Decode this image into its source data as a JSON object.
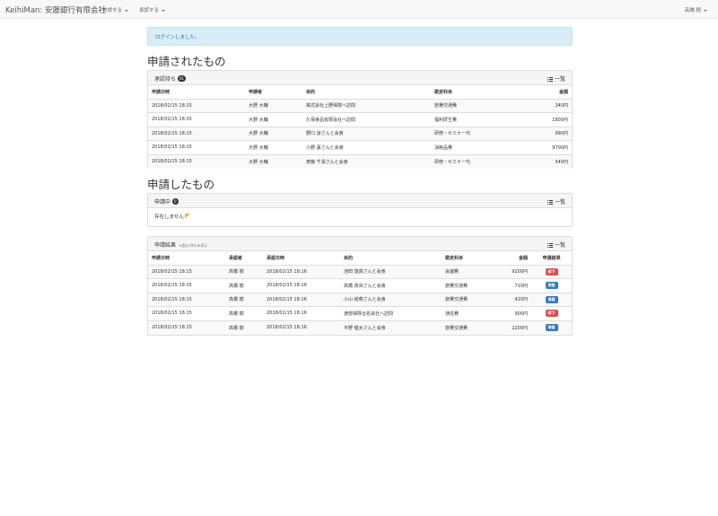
{
  "navbar": {
    "brand": "KeihiMan: 安藤銀行有限会社",
    "menu_apply": "申請する",
    "menu_approve": "承認する",
    "user": "高橋 樹"
  },
  "alert": {
    "message": "ログインしました。"
  },
  "sections": {
    "received_title": "申請されたもの",
    "mine_title": "申請したもの"
  },
  "pending": {
    "title": "承認待ち",
    "count": "81",
    "list_label": "一覧",
    "columns": [
      "申請日時",
      "申請者",
      "目的",
      "勘定科目",
      "金額"
    ],
    "rows": [
      [
        "2018/02/15 18:15",
        "大野 大輔",
        "株式会社上野保険へ訪問",
        "旅費交通費",
        "340円"
      ],
      [
        "2018/02/15 18:15",
        "大野 大輔",
        "久保食品有限会社へ訪問",
        "福利厚生費",
        "1800円"
      ],
      [
        "2018/02/15 18:15",
        "大野 大輔",
        "野口 涼さんと会食",
        "研修・セミナー代",
        "990円"
      ],
      [
        "2018/02/15 18:15",
        "大野 大輔",
        "小野 蓮さんと会食",
        "消耗品費",
        "9700円"
      ],
      [
        "2018/02/15 18:15",
        "大野 大輔",
        "斉藤 千尋さんと会食",
        "研修・セミナー代",
        "540円"
      ]
    ]
  },
  "applying": {
    "title": "申請中",
    "count": "0",
    "list_label": "一覧",
    "empty_text": "存在しません"
  },
  "results": {
    "title": "申請結果",
    "note": "※直近5件のみ表示",
    "list_label": "一覧",
    "columns": [
      "申請日時",
      "承認者",
      "承認日時",
      "目的",
      "勘定科目",
      "金額",
      "申請結果"
    ],
    "rows": [
      [
        "2018/02/15 18:15",
        "高橋 樹",
        "2018/02/15 18:16",
        "池田 悠真さんと会食",
        "会議費",
        "9200円",
        "却下"
      ],
      [
        "2018/02/15 18:15",
        "高橋 樹",
        "2018/02/15 18:16",
        "高橋 真央さんと会食",
        "旅費交通費",
        "710円",
        "承認"
      ],
      [
        "2018/02/15 18:15",
        "高橋 樹",
        "2018/02/15 18:16",
        "小山 結菜さんと会食",
        "旅費交通費",
        "420円",
        "承認"
      ],
      [
        "2018/02/15 18:15",
        "高橋 樹",
        "2018/02/15 18:16",
        "渡部保険合名会社へ訪問",
        "通信費",
        "900円",
        "却下"
      ],
      [
        "2018/02/15 18:15",
        "高橋 樹",
        "2018/02/15 18:16",
        "平野 健太さんと会食",
        "旅費交通費",
        "2200円",
        "承認"
      ]
    ],
    "status_colors": {
      "却下": "#d9534f",
      "承認": "#337ab7"
    }
  }
}
